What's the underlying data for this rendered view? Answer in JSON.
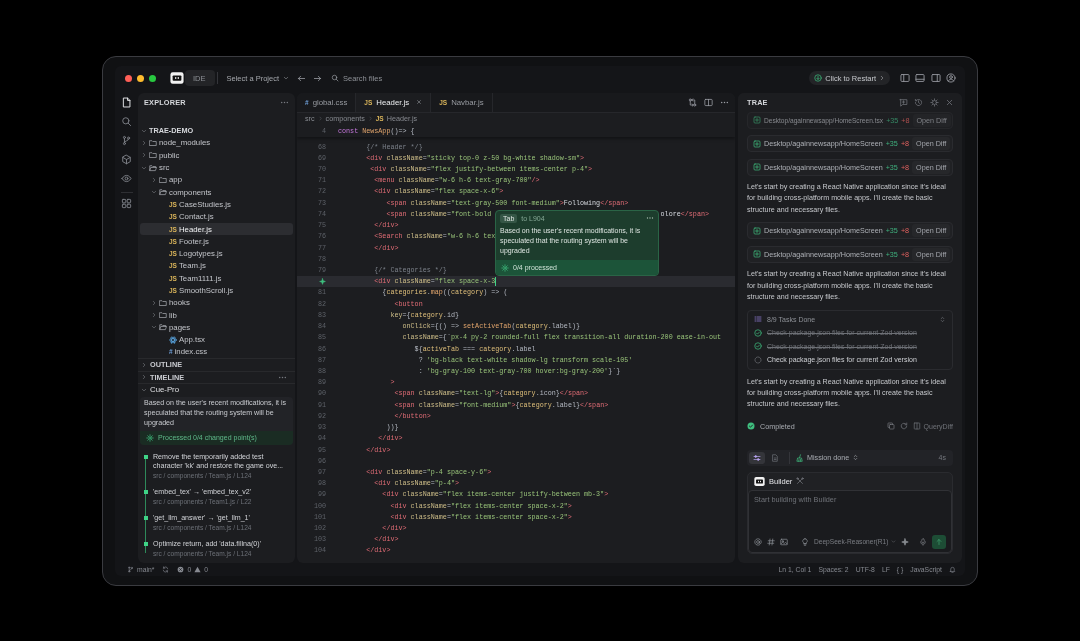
{
  "window": {
    "logo_label": "IDE",
    "project_selector": "Select a Project",
    "search": {
      "placeholder": "Search files"
    },
    "restart_button": "Click to Restart"
  },
  "activity_bar": [
    {
      "kind": "files",
      "selected": true
    },
    {
      "kind": "search",
      "selected": false
    },
    {
      "kind": "branch",
      "selected": false
    },
    {
      "kind": "extensions",
      "selected": false
    },
    {
      "kind": "preview",
      "selected": false
    },
    {
      "kind": "apps",
      "selected": false
    }
  ],
  "explorer": {
    "title": "EXPLORER",
    "tree": [
      {
        "label": "TRAE-DEMO",
        "kind": "root",
        "expanded": true,
        "selected": false,
        "children": [
          {
            "label": "node_modules",
            "kind": "folder",
            "expanded": false,
            "selected": false
          },
          {
            "label": "public",
            "kind": "folder",
            "expanded": false,
            "selected": false
          },
          {
            "label": "src",
            "kind": "folder",
            "expanded": true,
            "selected": false,
            "children": [
              {
                "label": "app",
                "kind": "folder",
                "expanded": false,
                "selected": false
              },
              {
                "label": "components",
                "kind": "folder",
                "expanded": true,
                "selected": false,
                "children": [
                  {
                    "label": "CaseStudies.js",
                    "kind": "js",
                    "badge": "JS",
                    "selected": false
                  },
                  {
                    "label": "Contact.js",
                    "kind": "js",
                    "badge": "JS",
                    "selected": false
                  },
                  {
                    "label": "Header.js",
                    "kind": "js",
                    "badge": "JS",
                    "selected": true
                  },
                  {
                    "label": "Footer.js",
                    "kind": "js",
                    "badge": "JS",
                    "selected": false
                  },
                  {
                    "label": "Logotypes.js",
                    "kind": "js",
                    "badge": "JS",
                    "selected": false
                  },
                  {
                    "label": "Team.js",
                    "kind": "js",
                    "badge": "JS",
                    "selected": false
                  },
                  {
                    "label": "Team1111.js",
                    "kind": "js",
                    "badge": "JS",
                    "selected": false
                  },
                  {
                    "label": "SmoothScroll.js",
                    "kind": "js",
                    "badge": "JS",
                    "selected": false
                  }
                ]
              },
              {
                "label": "hooks",
                "kind": "folder",
                "expanded": false,
                "selected": false
              },
              {
                "label": "lib",
                "kind": "folder",
                "expanded": false,
                "selected": false
              },
              {
                "label": "pages",
                "kind": "folder",
                "expanded": true,
                "selected": false,
                "children": [
                  {
                    "label": "App.tsx",
                    "kind": "tsx",
                    "selected": false
                  },
                  {
                    "label": "index.css",
                    "kind": "css",
                    "badge": "#",
                    "selected": false
                  }
                ]
              }
            ]
          }
        ]
      }
    ]
  },
  "sections": [
    {
      "label": "OUTLINE",
      "expanded": false
    },
    {
      "label": "TIMELINE",
      "expanded": false
    }
  ],
  "cue_pro": {
    "title": "Cue-Pro",
    "expanded": true,
    "description": "Based on the user's recent modifications, it is speculated that the routing system will be upgraded",
    "progress": "Processed 0/4 changed point(s)",
    "changes": [
      {
        "title": "Remove the temporarily added test character 'kk' and restore the game ove...",
        "location": "src / components / Team.js / L124"
      },
      {
        "title": "'embed_tex' → 'embed_tex_v2'",
        "location": "src / components / Team1.js / L22"
      },
      {
        "title": "'get_llm_answer' → 'get_llm_1'",
        "location": "src / components / Team.js / L124"
      },
      {
        "title": "Optimize return, add 'data.fillna(0)'",
        "location": "src / components / Team.js / L124"
      }
    ]
  },
  "editor": {
    "tabs": [
      {
        "badge": "#",
        "kind": "css",
        "label": "global.css",
        "selected": false
      },
      {
        "badge": "JS",
        "kind": "js",
        "label": "Header.js",
        "selected": true
      },
      {
        "badge": "JS",
        "kind": "js",
        "label": "Navbar.js",
        "selected": false
      }
    ],
    "breadcrumb": [
      {
        "label": "src"
      },
      {
        "label": "components"
      },
      {
        "badge": "JS",
        "kind": "js",
        "label": "Header.js"
      }
    ],
    "sticky_line": {
      "number": "4",
      "tokens": [
        {
          "kind": "kw",
          "text": "const "
        },
        {
          "kind": "fn",
          "text": "NewsApp"
        },
        {
          "kind": "pun",
          "text": "()=> {"
        }
      ]
    },
    "lines": [
      {
        "number": "68",
        "current": false,
        "tokens": [
          {
            "kind": "cmt",
            "text": "       {/* Header */}"
          }
        ]
      },
      {
        "number": "69",
        "current": false,
        "tokens": [
          {
            "kind": "tag",
            "text": "       <div "
          },
          {
            "kind": "attr",
            "text": "className"
          },
          {
            "kind": "pun",
            "text": "="
          },
          {
            "kind": "str",
            "text": "\"sticky top-0 z-50 bg-white shadow-sm\""
          },
          {
            "kind": "tag",
            "text": ">"
          }
        ]
      },
      {
        "number": "70",
        "current": false,
        "tokens": [
          {
            "kind": "tag",
            "text": "        <div "
          },
          {
            "kind": "attr",
            "text": "className"
          },
          {
            "kind": "pun",
            "text": "="
          },
          {
            "kind": "str",
            "text": "\"flex justify-between items-center p-4\""
          },
          {
            "kind": "tag",
            "text": ">"
          }
        ]
      },
      {
        "number": "71",
        "current": false,
        "tokens": [
          {
            "kind": "tag",
            "text": "         <menu "
          },
          {
            "kind": "attr",
            "text": "className"
          },
          {
            "kind": "pun",
            "text": "="
          },
          {
            "kind": "str",
            "text": "\"w-6 h-6 text-gray-700\""
          },
          {
            "kind": "tag",
            "text": "/>"
          }
        ]
      },
      {
        "number": "72",
        "current": false,
        "tokens": [
          {
            "kind": "tag",
            "text": "         <div "
          },
          {
            "kind": "attr",
            "text": "className"
          },
          {
            "kind": "pun",
            "text": "="
          },
          {
            "kind": "str",
            "text": "\"flex space-x-6\""
          },
          {
            "kind": "tag",
            "text": ">"
          }
        ]
      },
      {
        "number": "73",
        "current": false,
        "tokens": [
          {
            "kind": "tag",
            "text": "            <span "
          },
          {
            "kind": "attr",
            "text": "className"
          },
          {
            "kind": "pun",
            "text": "="
          },
          {
            "kind": "str",
            "text": "\"text-gray-500 font-medium\""
          },
          {
            "kind": "tag",
            "text": ">"
          },
          {
            "kind": "plain",
            "text": "Following"
          },
          {
            "kind": "tag",
            "text": "</span>"
          }
        ]
      },
      {
        "number": "74",
        "current": false,
        "tokens": [
          {
            "kind": "tag",
            "text": "            <span "
          },
          {
            "kind": "attr",
            "text": "className"
          },
          {
            "kind": "pun",
            "text": "="
          },
          {
            "kind": "str",
            "text": "\"font-bold"
          },
          {
            "kind": "gap"
          },
          {
            "kind": "plain",
            "text": "olore"
          },
          {
            "kind": "tag",
            "text": "</span>"
          }
        ]
      },
      {
        "number": "75",
        "current": false,
        "tokens": [
          {
            "kind": "tag",
            "text": "         </div>"
          }
        ]
      },
      {
        "number": "76",
        "current": false,
        "tokens": [
          {
            "kind": "tag",
            "text": "         <Search "
          },
          {
            "kind": "attr",
            "text": "className"
          },
          {
            "kind": "pun",
            "text": "="
          },
          {
            "kind": "str",
            "text": "\"w-6 h-6 tex"
          }
        ]
      },
      {
        "number": "77",
        "current": false,
        "tokens": [
          {
            "kind": "tag",
            "text": "         </div>"
          }
        ]
      },
      {
        "number": "78",
        "current": false
      },
      {
        "number": "79",
        "current": false,
        "tokens": [
          {
            "kind": "cmt",
            "text": "         {/* Categories */}"
          }
        ]
      },
      {
        "current": true,
        "tokens": [
          {
            "kind": "tag",
            "text": "         <div "
          },
          {
            "kind": "attr",
            "text": "className"
          },
          {
            "kind": "pun",
            "text": "="
          },
          {
            "kind": "str",
            "text": "\"flex space-x-3"
          }
        ]
      },
      {
        "number": "81",
        "current": false,
        "tokens": [
          {
            "kind": "pun",
            "text": "           {"
          },
          {
            "kind": "var",
            "text": "categories"
          },
          {
            "kind": "pun",
            "text": "."
          },
          {
            "kind": "fn",
            "text": "map"
          },
          {
            "kind": "pun",
            "text": "(("
          },
          {
            "kind": "var",
            "text": "category"
          },
          {
            "kind": "pun",
            "text": ") => ("
          }
        ]
      },
      {
        "number": "82",
        "current": false,
        "tokens": [
          {
            "kind": "tag",
            "text": "              <button"
          }
        ]
      },
      {
        "number": "83",
        "current": false,
        "tokens": [
          {
            "kind": "attr",
            "text": "             key"
          },
          {
            "kind": "pun",
            "text": "={"
          },
          {
            "kind": "var",
            "text": "category"
          },
          {
            "kind": "pun",
            "text": ".id}"
          }
        ]
      },
      {
        "number": "84",
        "current": false,
        "tokens": [
          {
            "kind": "attr",
            "text": "                onClick"
          },
          {
            "kind": "pun",
            "text": "={() => "
          },
          {
            "kind": "fn",
            "text": "setActiveTab"
          },
          {
            "kind": "pun",
            "text": "("
          },
          {
            "kind": "var",
            "text": "category"
          },
          {
            "kind": "pun",
            "text": ".label)}"
          }
        ]
      },
      {
        "number": "85",
        "current": false,
        "tokens": [
          {
            "kind": "attr",
            "text": "                className"
          },
          {
            "kind": "pun",
            "text": "={`"
          },
          {
            "kind": "str",
            "text": "px-4 py-2 rounded-full flex transition-all duration-200 ease-in-out"
          }
        ]
      },
      {
        "number": "86",
        "current": false,
        "tokens": [
          {
            "kind": "pun",
            "text": "                   ${"
          },
          {
            "kind": "var",
            "text": "activeTab"
          },
          {
            "kind": "pun",
            "text": " === "
          },
          {
            "kind": "var",
            "text": "category"
          },
          {
            "kind": "pun",
            "text": ".label"
          }
        ]
      },
      {
        "number": "87",
        "current": false,
        "tokens": [
          {
            "kind": "pun",
            "text": "                    ? "
          },
          {
            "kind": "str",
            "text": "'bg-black text-white shadow-lg transform scale-105'"
          }
        ]
      },
      {
        "number": "88",
        "current": false,
        "tokens": [
          {
            "kind": "pun",
            "text": "                    : "
          },
          {
            "kind": "str",
            "text": "'bg-gray-100 text-gray-700 hover:bg-gray-200'"
          },
          {
            "kind": "pun",
            "text": "}`}"
          }
        ]
      },
      {
        "number": "89",
        "current": false,
        "tokens": [
          {
            "kind": "tag",
            "text": "             >"
          }
        ]
      },
      {
        "number": "90",
        "current": false,
        "tokens": [
          {
            "kind": "tag",
            "text": "              <span "
          },
          {
            "kind": "attr",
            "text": "className"
          },
          {
            "kind": "pun",
            "text": "="
          },
          {
            "kind": "str",
            "text": "\"text-lg\""
          },
          {
            "kind": "tag",
            "text": ">"
          },
          {
            "kind": "pun",
            "text": "{"
          },
          {
            "kind": "var",
            "text": "category"
          },
          {
            "kind": "pun",
            "text": ".icon}"
          },
          {
            "kind": "tag",
            "text": "</span>"
          }
        ]
      },
      {
        "number": "91",
        "current": false,
        "tokens": [
          {
            "kind": "tag",
            "text": "              <span "
          },
          {
            "kind": "attr",
            "text": "className"
          },
          {
            "kind": "pun",
            "text": "="
          },
          {
            "kind": "str",
            "text": "\"font-medium\""
          },
          {
            "kind": "tag",
            "text": ">"
          },
          {
            "kind": "pun",
            "text": "{"
          },
          {
            "kind": "var",
            "text": "category"
          },
          {
            "kind": "pun",
            "text": ".label}"
          },
          {
            "kind": "tag",
            "text": "</span>"
          }
        ]
      },
      {
        "number": "92",
        "current": false,
        "tokens": [
          {
            "kind": "tag",
            "text": "              </button>"
          }
        ]
      },
      {
        "number": "93",
        "current": false,
        "tokens": [
          {
            "kind": "pun",
            "text": "            ))}"
          }
        ]
      },
      {
        "number": "94",
        "current": false,
        "tokens": [
          {
            "kind": "tag",
            "text": "          </div>"
          }
        ]
      },
      {
        "number": "95",
        "current": false,
        "tokens": [
          {
            "kind": "tag",
            "text": "       </div>"
          }
        ]
      },
      {
        "number": "96",
        "current": false
      },
      {
        "number": "97",
        "current": false,
        "tokens": [
          {
            "kind": "tag",
            "text": "       <div "
          },
          {
            "kind": "attr",
            "text": "className"
          },
          {
            "kind": "pun",
            "text": "="
          },
          {
            "kind": "str",
            "text": "\"p-4 space-y-6\""
          },
          {
            "kind": "tag",
            "text": ">"
          }
        ]
      },
      {
        "number": "98",
        "current": false,
        "tokens": [
          {
            "kind": "tag",
            "text": "         <div "
          },
          {
            "kind": "attr",
            "text": "className"
          },
          {
            "kind": "pun",
            "text": "="
          },
          {
            "kind": "str",
            "text": "\"p-4\""
          },
          {
            "kind": "tag",
            "text": ">"
          }
        ]
      },
      {
        "number": "99",
        "current": false,
        "tokens": [
          {
            "kind": "tag",
            "text": "           <div "
          },
          {
            "kind": "attr",
            "text": "className"
          },
          {
            "kind": "pun",
            "text": "="
          },
          {
            "kind": "str",
            "text": "\"flex items-center justify-between mb-3\""
          },
          {
            "kind": "tag",
            "text": ">"
          }
        ]
      },
      {
        "number": "100",
        "current": false,
        "tokens": [
          {
            "kind": "tag",
            "text": "             <div "
          },
          {
            "kind": "attr",
            "text": "className"
          },
          {
            "kind": "pun",
            "text": "="
          },
          {
            "kind": "str",
            "text": "\"flex items-center space-x-2\""
          },
          {
            "kind": "tag",
            "text": ">"
          }
        ]
      },
      {
        "number": "101",
        "current": false,
        "tokens": [
          {
            "kind": "tag",
            "text": "             <div "
          },
          {
            "kind": "attr",
            "text": "className"
          },
          {
            "kind": "pun",
            "text": "="
          },
          {
            "kind": "str",
            "text": "\"flex items-center space-x-2\""
          },
          {
            "kind": "tag",
            "text": ">"
          }
        ]
      },
      {
        "number": "102",
        "current": false,
        "tokens": [
          {
            "kind": "tag",
            "text": "           </div>"
          }
        ]
      },
      {
        "number": "103",
        "current": false,
        "tokens": [
          {
            "kind": "tag",
            "text": "         </div>"
          }
        ]
      },
      {
        "number": "104",
        "current": false,
        "tokens": [
          {
            "kind": "tag",
            "text": "       </div>"
          }
        ]
      }
    ],
    "suggestion": {
      "key": "Tab",
      "target": "to L904",
      "text": "Based on the user's recent modifications, it is speculated that the routing system will be upgraded",
      "progress": "0/4 processed"
    }
  },
  "assistant": {
    "title": "TRAE",
    "messages": [
      {
        "kind": "diff",
        "dimmed": true,
        "path": "Desktop/againnewsapp/HomeScreen.tsx",
        "added": "+35",
        "removed": "+8",
        "button": "Open Diff"
      },
      {
        "kind": "diff",
        "dimmed": false,
        "path": "Desktop/againnewsapp/HomeScreen",
        "added": "+35",
        "removed": "+8",
        "button": "Open Diff"
      },
      {
        "kind": "diff",
        "dimmed": false,
        "path": "Desktop/againnewsapp/HomeScreen",
        "added": "+35",
        "removed": "+8",
        "button": "Open Diff"
      },
      {
        "kind": "text",
        "text": "Let's start by creating a React Native application since it's ideal for building cross-platform mobile apps. I'll create the basic structure and necessary files."
      },
      {
        "kind": "diff",
        "dimmed": false,
        "path": "Desktop/againnewsapp/HomeScreen",
        "added": "+35",
        "removed": "+8",
        "button": "Open Diff"
      },
      {
        "kind": "diff",
        "dimmed": false,
        "path": "Desktop/againnewsapp/HomeScreen",
        "added": "+35",
        "removed": "+8",
        "button": "Open Diff"
      },
      {
        "kind": "text",
        "text": "Let's start by creating a React Native application since it's ideal for building cross-platform mobile apps. I'll create the basic structure and necessary files."
      },
      {
        "kind": "tasks",
        "summary": "8/9 Tasks Done",
        "items": [
          {
            "text": "Check package.json files for current Zod version",
            "done": true
          },
          {
            "text": "Check package.json files for current Zod version",
            "done": true
          },
          {
            "text": "Check package.json files for current Zod version",
            "done": false
          }
        ]
      },
      {
        "kind": "text",
        "text": "Let's start by creating a React Native application since it's ideal for building cross-platform mobile apps. I'll create the basic structure and necessary files."
      },
      {
        "kind": "status",
        "label": "Completed",
        "action": "QueryDiff"
      }
    ],
    "mode_bar": {
      "modes": [
        {
          "kind": "tasks",
          "selected": true
        },
        {
          "kind": "file",
          "selected": false
        }
      ],
      "status": "Mission done",
      "elapsed": "4s"
    },
    "composer": {
      "agent": "Builder",
      "placeholder": "Start building with Builder",
      "model": "DeepSeek-Reasoner(R1)"
    }
  },
  "status_bar": {
    "branch": "main*",
    "errors": "0",
    "warnings": "0",
    "items": [
      "Ln 1, Col 1",
      "Spaces: 2",
      "UTF-8",
      "LF",
      "{ }",
      "JavaScript"
    ]
  }
}
